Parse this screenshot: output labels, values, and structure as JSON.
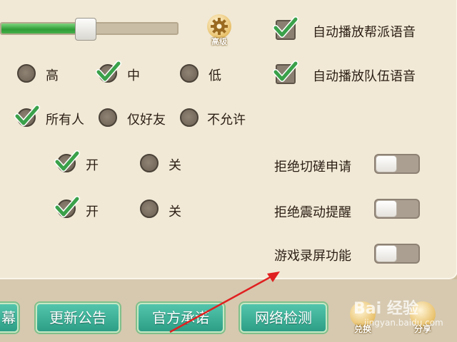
{
  "graphics_slider": {
    "value_fraction": 0.45
  },
  "advanced_button": {
    "label": "高级",
    "icon": "gear-icon"
  },
  "quality": {
    "options": [
      "高",
      "中",
      "低"
    ],
    "selected": "中"
  },
  "visibility": {
    "options": [
      "所有人",
      "仅好友",
      "不允许"
    ],
    "selected": "所有人"
  },
  "row_a": {
    "on_label": "开",
    "off_label": "关",
    "selected": "开"
  },
  "row_b": {
    "on_label": "开",
    "off_label": "关",
    "selected": "开"
  },
  "checkboxes": [
    {
      "label": "自动播放帮派语音",
      "checked": true
    },
    {
      "label": "自动播放队伍语音",
      "checked": true
    }
  ],
  "toggles": [
    {
      "label": "拒绝切磋申请",
      "on": false
    },
    {
      "label": "拒绝震动提醒",
      "on": false
    },
    {
      "label": "游戏录屏功能",
      "on": false
    }
  ],
  "footer_buttons": [
    {
      "label": "幕"
    },
    {
      "label": "更新公告"
    },
    {
      "label": "官方承诺"
    },
    {
      "label": "网络检测"
    }
  ],
  "round_buttons": [
    {
      "label": "兑换",
      "icon": "exchange-icon"
    },
    {
      "label": "分享",
      "icon": "share-icon"
    }
  ],
  "watermark": {
    "text": "Bai 经验",
    "sub": "jingyan.baidu.com"
  },
  "colors": {
    "check": "#3aa14a",
    "arrow": "#e02020",
    "button": "#3aae96"
  }
}
